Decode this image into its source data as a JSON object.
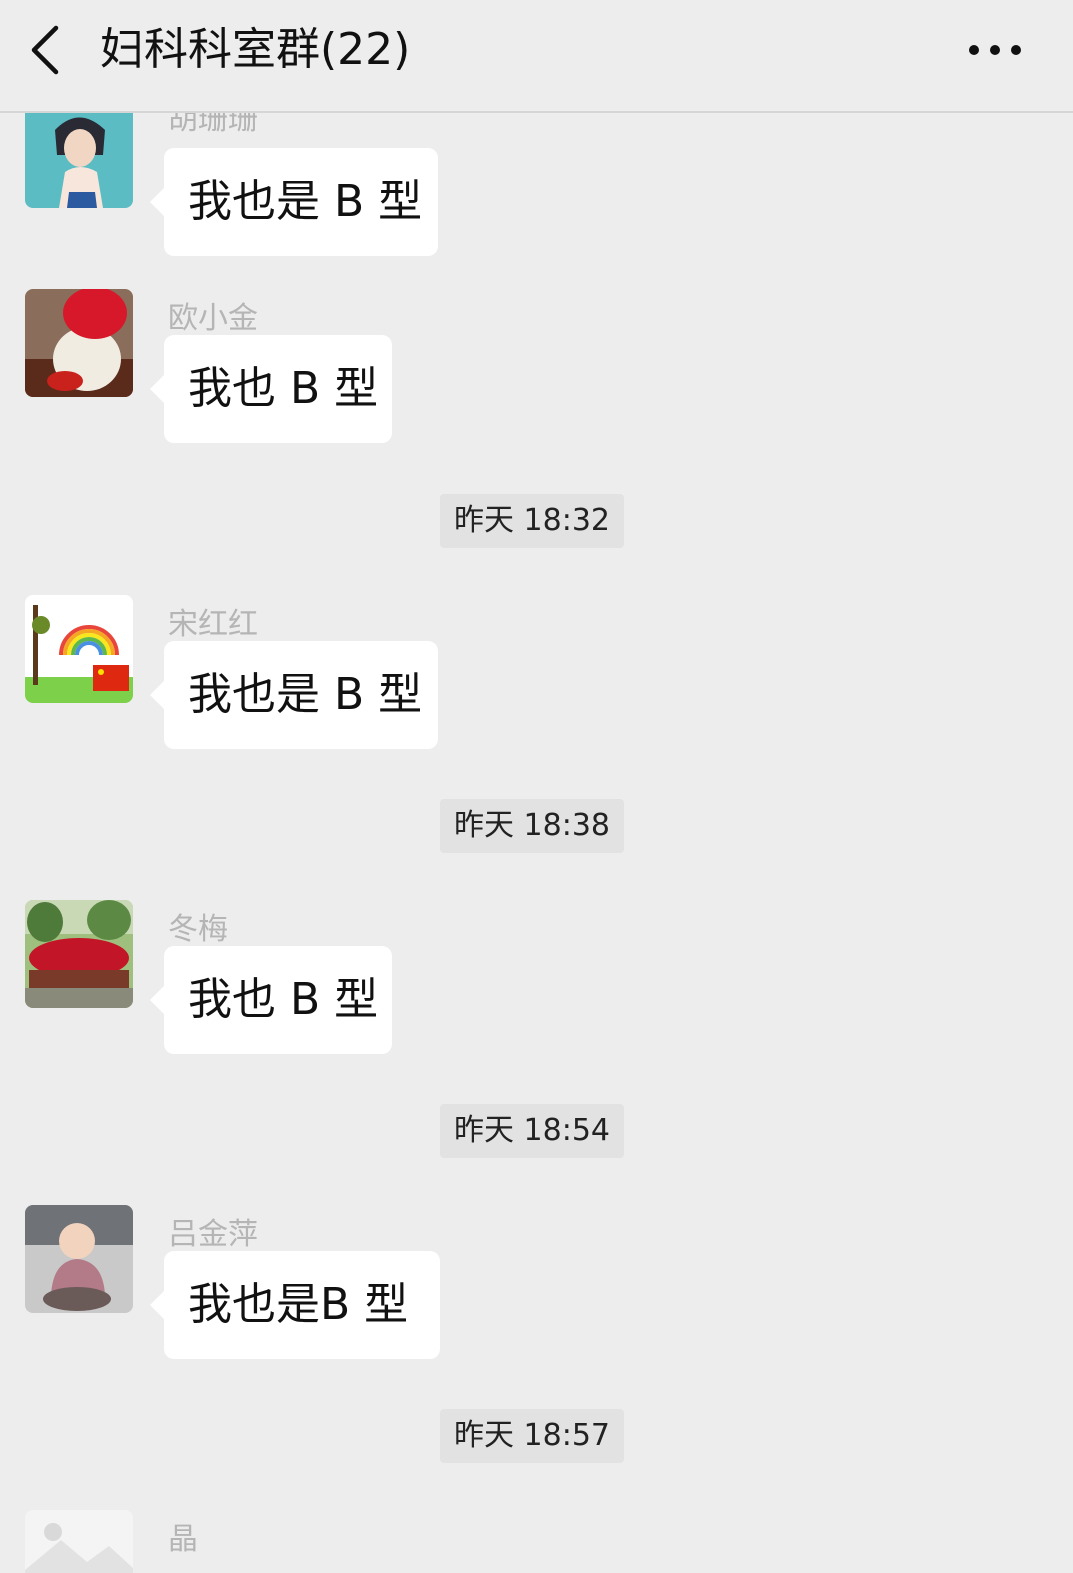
{
  "header": {
    "title": "妇科科室群(22)",
    "back_icon": "chevron-left-icon",
    "more_icon": "more-dots-icon"
  },
  "messages": [
    {
      "sender": "胡珊珊",
      "text": "我也是 B 型"
    },
    {
      "sender": "欧小金",
      "text": "我也 B 型"
    },
    {
      "sender": "宋红红",
      "text": "我也是 B 型"
    },
    {
      "sender": "冬梅",
      "text": "我也 B 型"
    },
    {
      "sender": "吕金萍",
      "text": "我也是B 型"
    },
    {
      "sender": "晶",
      "text": ""
    }
  ],
  "timestamps": [
    "昨天 18:32",
    "昨天 18:38",
    "昨天 18:54",
    "昨天 18:57"
  ],
  "colors": {
    "background": "#ededed",
    "bubble": "#ffffff",
    "sender_name": "#b5b5b5",
    "time_badge": "#e2e2e2"
  }
}
